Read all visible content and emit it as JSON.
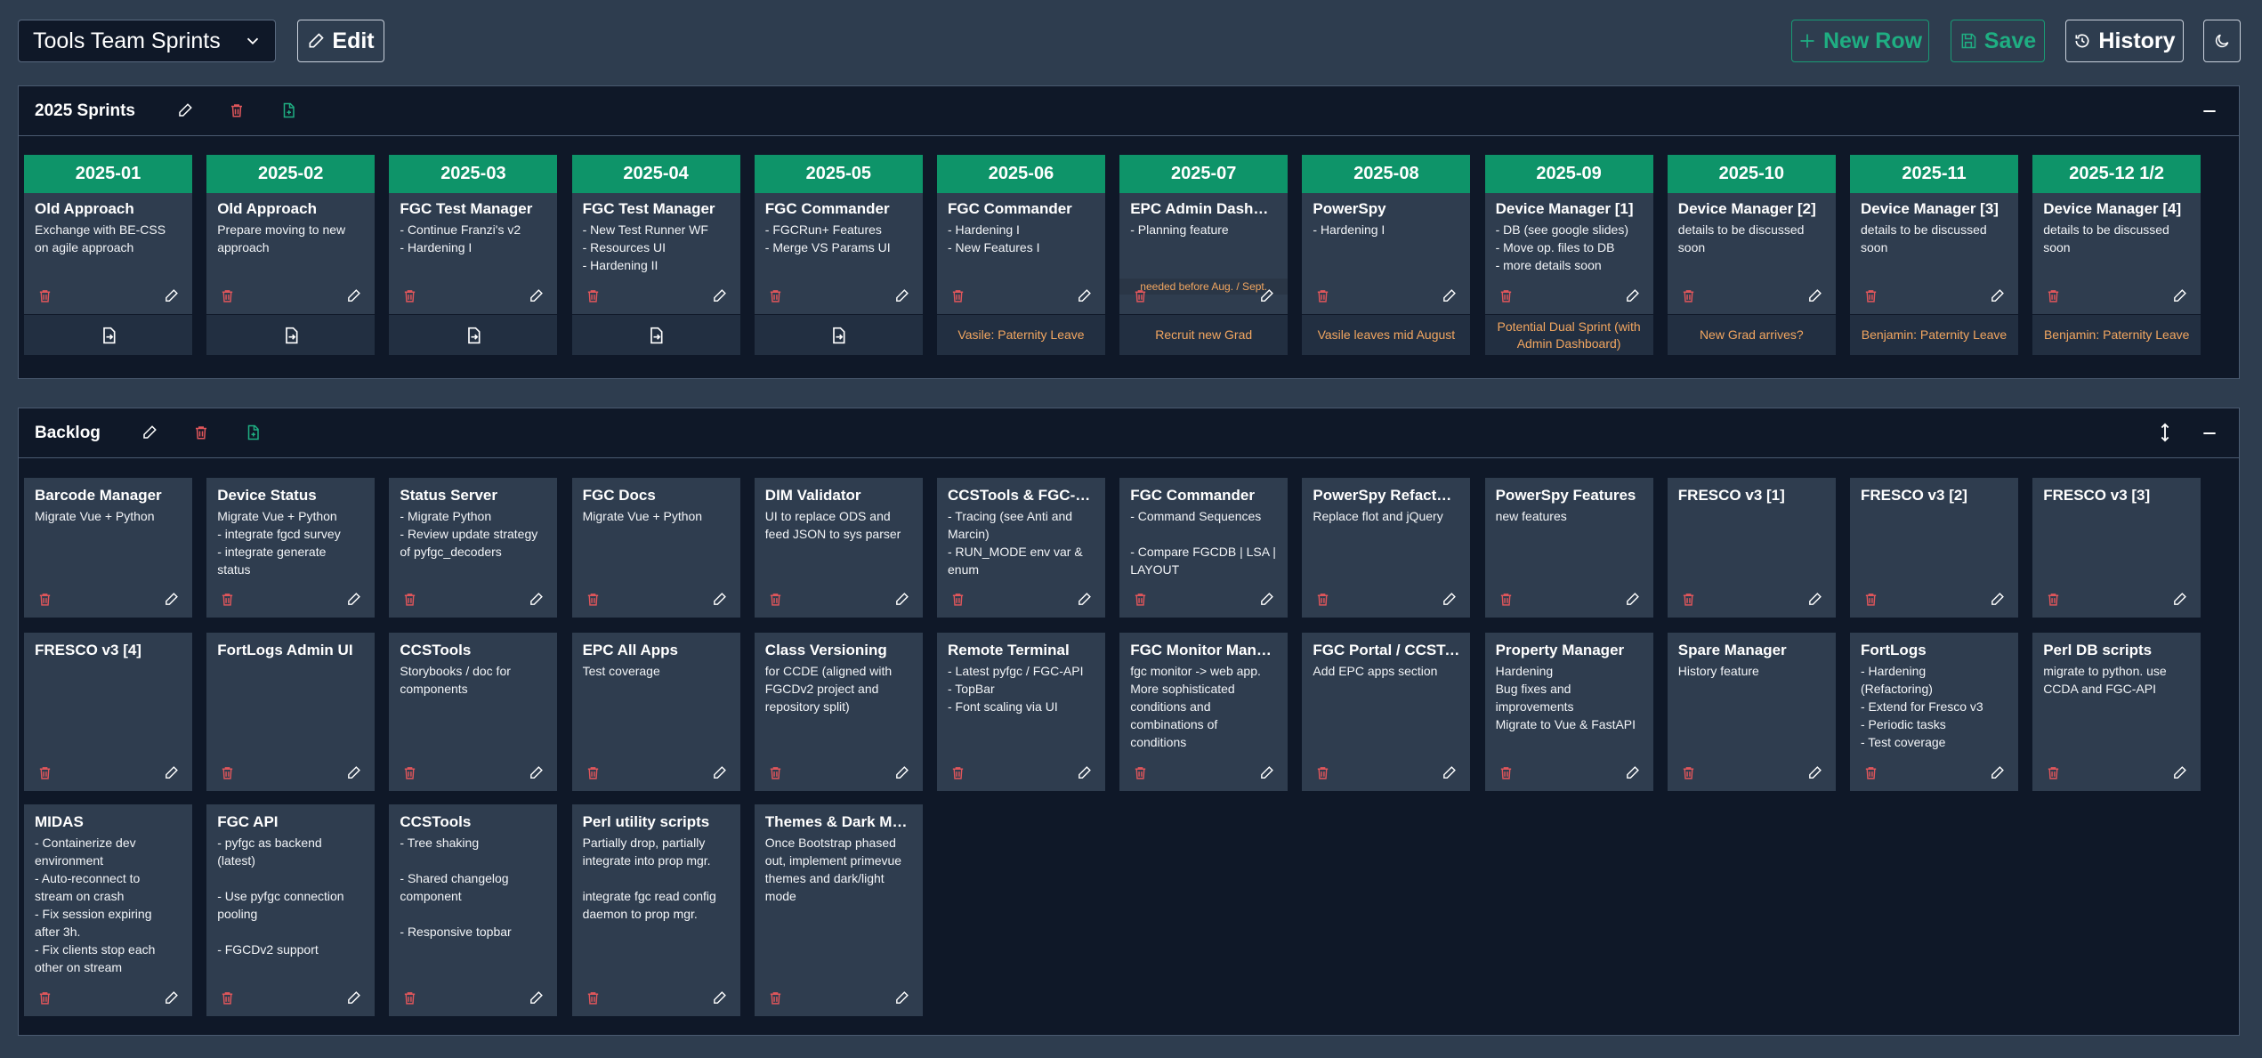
{
  "topbar": {
    "board_select": "Tools Team Sprints",
    "edit_label": "Edit",
    "new_row_label": "New Row",
    "save_label": "Save",
    "history_label": "History"
  },
  "sprints": {
    "title": "2025 Sprints",
    "columns": [
      {
        "header": "2025-01",
        "title": "Old Approach",
        "body": "Exchange with BE-CSS\non agile approach",
        "note": "",
        "footer": ""
      },
      {
        "header": "2025-02",
        "title": "Old Approach",
        "body": "Prepare moving to new\napproach",
        "note": "",
        "footer": ""
      },
      {
        "header": "2025-03",
        "title": "FGC Test Manager",
        "body": "- Continue Franzi's v2\n- Hardening I",
        "note": "",
        "footer": ""
      },
      {
        "header": "2025-04",
        "title": "FGC Test Manager",
        "body": "- New Test Runner WF\n- Resources UI\n- Hardening II",
        "note": "",
        "footer": ""
      },
      {
        "header": "2025-05",
        "title": "FGC Commander",
        "body": "- FGCRun+ Features\n- Merge VS Params UI",
        "note": "",
        "footer": ""
      },
      {
        "header": "2025-06",
        "title": "FGC Commander",
        "body": "- Hardening I\n- New Features I",
        "note": "",
        "footer": "Vasile: Paternity Leave"
      },
      {
        "header": "2025-07",
        "title": "EPC Admin Dashboa...",
        "body": "- Planning feature",
        "note": "needed before Aug. / Sept.",
        "footer": "Recruit new Grad"
      },
      {
        "header": "2025-08",
        "title": "PowerSpy",
        "body": "- Hardening I",
        "note": "",
        "footer": "Vasile leaves mid August"
      },
      {
        "header": "2025-09",
        "title": "Device Manager [1]",
        "body": "- DB (see google slides)\n- Move op. files to DB\n- more details soon",
        "note": "",
        "footer": "Potential Dual Sprint (with Admin Dashboard)"
      },
      {
        "header": "2025-10",
        "title": "Device Manager [2]",
        "body": "details to be discussed\nsoon",
        "note": "",
        "footer": "New Grad arrives?"
      },
      {
        "header": "2025-11",
        "title": "Device Manager [3]",
        "body": "details to be discussed\nsoon",
        "note": "",
        "footer": "Benjamin: Paternity Leave"
      },
      {
        "header": "2025-12 1/2",
        "title": "Device Manager [4]",
        "body": "details to be discussed\nsoon",
        "note": "",
        "footer": "Benjamin: Paternity Leave"
      }
    ]
  },
  "backlog": {
    "title": "Backlog",
    "rows": [
      [
        {
          "title": "Barcode Manager",
          "body": "Migrate Vue + Python"
        },
        {
          "title": "Device Status",
          "body": "Migrate Vue + Python\n- integrate fgcd survey\n- integrate generate\nstatus"
        },
        {
          "title": "Status Server",
          "body": "- Migrate Python\n- Review update strategy\nof pyfgc_decoders"
        },
        {
          "title": "FGC Docs",
          "body": "Migrate Vue + Python"
        },
        {
          "title": "DIM Validator",
          "body": "UI to replace ODS and\nfeed JSON to sys parser"
        },
        {
          "title": "CCSTools & FGC-API",
          "body": "- Tracing (see Anti and\nMarcin)\n- RUN_MODE env var &\nenum"
        },
        {
          "title": "FGC Commander",
          "body": "- Command Sequences\n\n- Compare FGCDB | LSA |\nLAYOUT"
        },
        {
          "title": "PowerSpy Refactoring",
          "body": "Replace flot and jQuery"
        },
        {
          "title": "PowerSpy Features",
          "body": "new features"
        },
        {
          "title": "FRESCO v3 [1]",
          "body": ""
        },
        {
          "title": "FRESCO v3 [2]",
          "body": ""
        },
        {
          "title": "FRESCO v3 [3]",
          "body": ""
        }
      ],
      [
        {
          "title": "FRESCO v3 [4]",
          "body": ""
        },
        {
          "title": "FortLogs Admin UI",
          "body": ""
        },
        {
          "title": "CCSTools",
          "body": "Storybooks / doc for\ncomponents"
        },
        {
          "title": "EPC All Apps",
          "body": "Test coverage"
        },
        {
          "title": "Class Versioning",
          "body": "for CCDE (aligned with\nFGCDv2 project and\nrepository split)"
        },
        {
          "title": "Remote Terminal",
          "body": "- Latest pyfgc / FGC-API\n- TopBar\n- Font scaling via UI"
        },
        {
          "title": "FGC Monitor Manager",
          "body": "fgc monitor -> web app.\nMore sophisticated\nconditions and\ncombinations of\nconditions"
        },
        {
          "title": "FGC Portal / CCSTools",
          "body": "Add EPC apps section"
        },
        {
          "title": "Property Manager",
          "body": "Hardening\nBug fixes and\nimprovements\nMigrate to Vue & FastAPI"
        },
        {
          "title": "Spare Manager",
          "body": "History feature"
        },
        {
          "title": "FortLogs",
          "body": "- Hardening\n(Refactoring)\n- Extend for Fresco v3\n- Periodic tasks\n- Test coverage"
        },
        {
          "title": "Perl DB scripts",
          "body": "migrate to python. use\nCCDA and FGC-API"
        }
      ],
      [
        {
          "title": "MIDAS",
          "body": "- Containerize dev\nenvironment\n- Auto-reconnect to\nstream on crash\n- Fix session expiring\nafter 3h.\n- Fix clients stop each\nother on stream"
        },
        {
          "title": "FGC API",
          "body": "- pyfgc as backend\n(latest)\n\n- Use pyfgc connection\npooling\n\n- FGCDv2 support"
        },
        {
          "title": "CCSTools",
          "body": "- Tree shaking\n\n- Shared changelog\ncomponent\n\n- Responsive topbar"
        },
        {
          "title": "Perl utility scripts",
          "body": "Partially drop, partially\nintegrate into prop mgr.\n\nintegrate fgc read config\ndaemon to prop mgr."
        },
        {
          "title": "Themes & Dark Mode",
          "body": "Once Bootstrap phased\nout, implement primevue\nthemes and dark/light\nmode"
        }
      ]
    ]
  },
  "colors": {
    "background": "#2e3d4f",
    "panel": "#0f1828",
    "card": "#2f3d4f",
    "sprint_header": "#0e9469",
    "accent_green": "#1fae82",
    "danger": "#e0565b",
    "warning_text": "#f2a660"
  },
  "icons": {
    "edit": "pencil-icon",
    "delete": "trash-icon",
    "add": "file-plus-icon",
    "history": "history-icon",
    "theme": "moon-icon",
    "move": "move-to-sprint-icon",
    "collapse": "minus-icon",
    "expand": "expand-vertical-icon"
  }
}
